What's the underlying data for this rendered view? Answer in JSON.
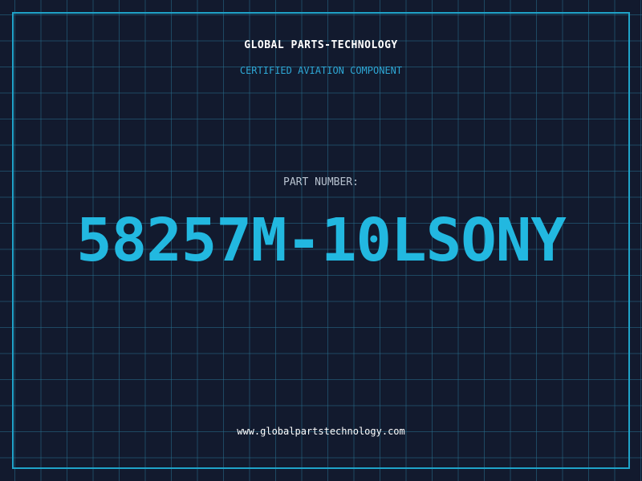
{
  "header": {
    "brand": "GLOBAL PARTS-TECHNOLOGY",
    "subtitle": "CERTIFIED AVIATION COMPONENT"
  },
  "part": {
    "label": "PART NUMBER:",
    "number": "58257M-10LSONY"
  },
  "footer": {
    "url": "www.globalpartstechnology.com"
  },
  "colors": {
    "background": "#121a2e",
    "grid": "#286e8c",
    "accent": "#22b8e0",
    "frame": "#1fa3c9"
  }
}
